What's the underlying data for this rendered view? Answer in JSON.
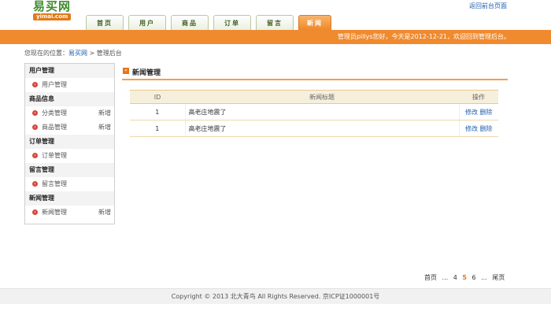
{
  "logo": {
    "cn": "易买网",
    "en": "yimai.com"
  },
  "header": {
    "back_link": "返回前台页面"
  },
  "nav": {
    "tabs": [
      {
        "label": "首页"
      },
      {
        "label": "用户"
      },
      {
        "label": "商品"
      },
      {
        "label": "订单"
      },
      {
        "label": "留言"
      },
      {
        "label": "新闻",
        "active": true
      }
    ]
  },
  "welcome": "管理员pillys您好，今天是2012-12-21，欢迎回到管理后台。",
  "breadcrumb": {
    "prefix": "您现在的位置：",
    "home": "易买网",
    "sep": ">",
    "current": "管理后台"
  },
  "sidebar": {
    "sections": [
      {
        "title": "用户管理",
        "items": [
          {
            "label": "用户管理",
            "extra": ""
          }
        ]
      },
      {
        "title": "商品信息",
        "items": [
          {
            "label": "分类管理",
            "extra": "新增"
          },
          {
            "label": "商品管理",
            "extra": "新增"
          }
        ]
      },
      {
        "title": "订单管理",
        "items": [
          {
            "label": "订单管理",
            "extra": ""
          }
        ]
      },
      {
        "title": "留言管理",
        "items": [
          {
            "label": "留言管理",
            "extra": ""
          }
        ]
      },
      {
        "title": "新闻管理",
        "items": [
          {
            "label": "新闻管理",
            "extra": "新增"
          }
        ]
      }
    ]
  },
  "main": {
    "title": "新闻管理",
    "table": {
      "headers": {
        "id": "ID",
        "title": "新闻标题",
        "op": "操作"
      },
      "rows": [
        {
          "id": "1",
          "title": "高老庄地震了",
          "edit": "修改",
          "del": "删除"
        },
        {
          "id": "1",
          "title": "高老庄地震了",
          "edit": "修改",
          "del": "删除"
        }
      ]
    }
  },
  "pager": {
    "first": "首页",
    "dots1": "...",
    "p4": "4",
    "p5": "5",
    "p6": "6",
    "dots2": "...",
    "last": "尾页"
  },
  "footer": "Copyright © 2013 北大青鸟 All Rights Reserved. 京ICP证1000001号",
  "colors": {
    "accent": "#f08a2e",
    "brand_green": "#3f8b2c",
    "link": "#1f5fae"
  },
  "icons": {
    "sidebar_bullet": "arrow-bullet-icon",
    "panel": "panel-arrow-icon"
  }
}
